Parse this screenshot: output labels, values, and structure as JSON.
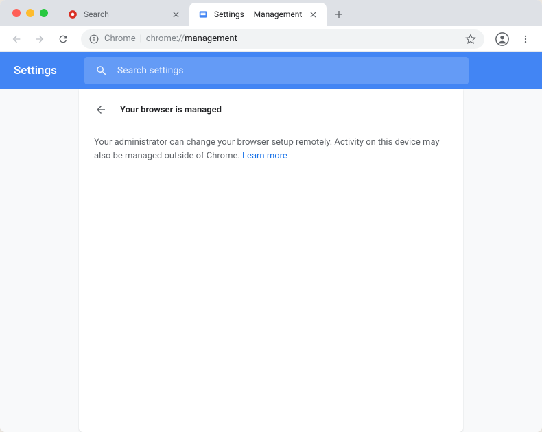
{
  "window": {
    "controls": [
      "close",
      "minimize",
      "maximize"
    ]
  },
  "tabs": [
    {
      "title": "Search",
      "active": false,
      "favicon": "search-favicon"
    },
    {
      "title": "Settings – Management",
      "active": true,
      "favicon": "chrome-settings-favicon"
    }
  ],
  "toolbar": {
    "back_enabled": false,
    "forward_enabled": false,
    "address": {
      "origin": "Chrome",
      "prefix": "chrome://",
      "path": "management"
    }
  },
  "settings": {
    "header_title": "Settings",
    "search_placeholder": "Search settings",
    "card": {
      "title": "Your browser is managed",
      "body_text": "Your administrator can change your browser setup remotely. Activity on this device may also be managed outside of Chrome. ",
      "learn_more_label": "Learn more"
    }
  }
}
